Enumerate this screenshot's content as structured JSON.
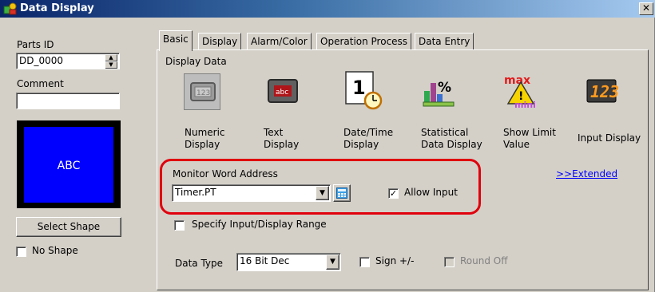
{
  "window": {
    "title": "Data Display",
    "close_label": "✕"
  },
  "left": {
    "parts_id_label": "Parts ID",
    "parts_id_value": "DD_0000",
    "comment_label": "Comment",
    "comment_value": "",
    "preview_text": "ABC",
    "select_shape_label": "Select Shape",
    "no_shape_label": "No Shape",
    "no_shape_checked": false
  },
  "tabs": [
    {
      "label": "Basic",
      "active": true
    },
    {
      "label": "Display"
    },
    {
      "label": "Alarm/Color"
    },
    {
      "label": "Operation Process"
    },
    {
      "label": "Data Entry"
    }
  ],
  "display_data": {
    "title": "Display Data",
    "items": [
      {
        "label1": "Numeric",
        "label2": "Display",
        "icon": "numeric-display-icon",
        "selected": true
      },
      {
        "label1": "Text",
        "label2": "Display",
        "icon": "text-display-icon"
      },
      {
        "label1": "Date/Time",
        "label2": "Display",
        "icon": "datetime-display-icon"
      },
      {
        "label1": "Statistical",
        "label2": "Data Display",
        "icon": "statistical-display-icon"
      },
      {
        "label1": "Show Limit",
        "label2": "Value",
        "icon": "show-limit-icon"
      },
      {
        "label1": "Input Display",
        "label2": "",
        "icon": "input-display-icon"
      }
    ]
  },
  "monitor": {
    "label": "Monitor Word Address",
    "value": "Timer.PT",
    "allow_input_label": "Allow Input",
    "allow_input_checked": true,
    "extended_link": ">>Extended"
  },
  "range": {
    "label": "Specify Input/Display Range",
    "checked": false
  },
  "data_type": {
    "label": "Data Type",
    "value": "16 Bit Dec",
    "sign_label": "Sign +/-",
    "round_label": "Round Off"
  },
  "colors": {
    "highlight": "#e0000c",
    "preview_bg": "#0000ff",
    "title_bar": "#0a246a"
  }
}
